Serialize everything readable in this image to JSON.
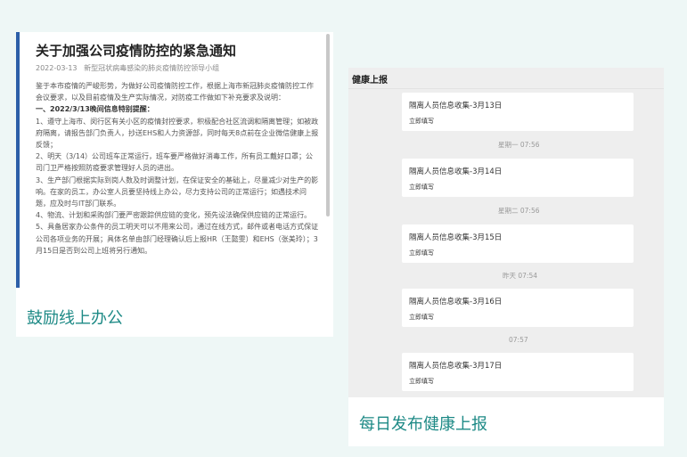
{
  "left_panel": {
    "notice": {
      "title": "关于加强公司疫情防控的紧急通知",
      "meta_date": "2022-03-13",
      "meta_source": "新型冠状病毒感染的肺炎疫情防控领导小组",
      "intro": "鉴于本市疫情的严峻形势，为做好公司疫情防控工作，根据上海市新冠肺炎疫情防控工作会议要求，以及目前疫情及生产实际情况，对防疫工作做如下补充要求及说明：",
      "section_heading": "一、2022/3/13晚间信息特别提醒：",
      "items": [
        "1、遵守上海市、闵行区有关小区的疫情封控要求，积极配合社区流调和隔离管理；如被政府隔离，请报告部门负责人，抄送EHS和人力资源部，同时每天8点前在企业微信健康上报反馈；",
        "2、明天（3/14）公司班车正常运行，班车要严格做好消毒工作，所有员工戴好口罩；公司门卫严格按照防疫要求管理好人员的进出。",
        "3、生产部门根据实际到岗人数及时调整计划，在保证安全的基础上，尽量减少对生产的影响。在家的员工，办公室人员要坚持线上办公，尽力支持公司的正常运行；如遇技术问题，应及时与IT部门联系。",
        "4、物流、计划和采购部门要严密跟踪供应链的变化，预先设法确保供应链的正常运行。",
        "5、具备居家办公条件的员工明天可以不用来公司，通过在线方式，邮件或者电话方式保证公司各项业务的开展；具体名单由部门经理确认后上报HR（王懿雯）和EHS（张美玲）；3月15日是否到公司上班将另行通知。"
      ]
    },
    "caption": "鼓励线上办公"
  },
  "right_panel": {
    "header_title": "健康上报",
    "messages": [
      {
        "title": "隔离人员信息收集-3月13日",
        "action": "立即填写",
        "time": ""
      },
      {
        "title": "隔离人员信息收集-3月14日",
        "action": "立即填写",
        "time": "星期一 07:56"
      },
      {
        "title": "隔离人员信息收集-3月15日",
        "action": "立即填写",
        "time": "星期二 07:56"
      },
      {
        "title": "隔离人员信息收集-3月16日",
        "action": "立即填写",
        "time": "昨天 07:54"
      },
      {
        "title": "隔离人员信息收集-3月17日",
        "action": "立即填写",
        "time": "07:57"
      }
    ],
    "caption": "每日发布健康上报"
  },
  "colors": {
    "page_background": "#eef7f6",
    "caption_teal": "#1e8a86",
    "accent_blue": "#2c5fa8",
    "chat_background": "#eeeeee"
  }
}
